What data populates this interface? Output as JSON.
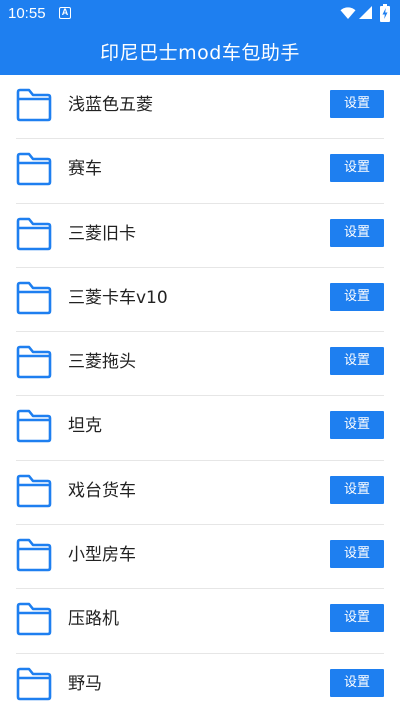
{
  "status_bar": {
    "time": "10:55",
    "app_icon_letter": "A",
    "icons": [
      "wifi-icon",
      "cell-signal-icon",
      "battery-charging-icon"
    ]
  },
  "header": {
    "title": "印尼巴士mod车包助手"
  },
  "colors": {
    "accent": "#1e7ff0",
    "folder": "#1e7ff0",
    "text": "#222222",
    "divider": "#e6e6e6"
  },
  "list": {
    "items": [
      {
        "label": "浅蓝色五菱",
        "button": "设置",
        "icon": "folder-icon"
      },
      {
        "label": "赛车",
        "button": "设置",
        "icon": "folder-icon"
      },
      {
        "label": "三菱旧卡",
        "button": "设置",
        "icon": "folder-icon"
      },
      {
        "label": "三菱卡车v10",
        "button": "设置",
        "icon": "folder-icon"
      },
      {
        "label": "三菱拖头",
        "button": "设置",
        "icon": "folder-icon"
      },
      {
        "label": "坦克",
        "button": "设置",
        "icon": "folder-icon"
      },
      {
        "label": "戏台货车",
        "button": "设置",
        "icon": "folder-icon"
      },
      {
        "label": "小型房车",
        "button": "设置",
        "icon": "folder-icon"
      },
      {
        "label": "压路机",
        "button": "设置",
        "icon": "folder-icon"
      },
      {
        "label": "野马",
        "button": "设置",
        "icon": "folder-icon"
      }
    ]
  }
}
